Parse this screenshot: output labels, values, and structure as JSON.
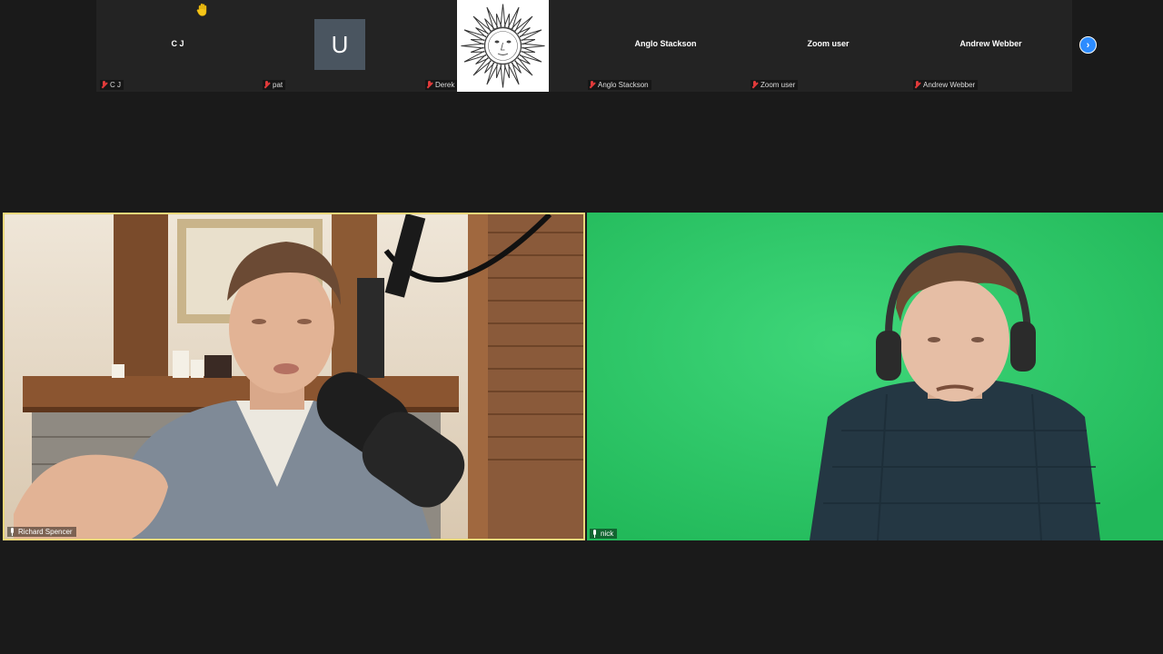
{
  "thumbnails": [
    {
      "name": "C J",
      "label": "C J",
      "muted": true
    },
    {
      "name": "",
      "label": "pat",
      "muted": true,
      "avatar_letter": "U"
    },
    {
      "name": "",
      "label": "Derek C",
      "muted": true
    },
    {
      "name": "Anglo Stackson",
      "label": "Anglo Stackson",
      "muted": true
    },
    {
      "name": "Zoom user",
      "label": "Zoom user",
      "muted": true
    },
    {
      "name": "Andrew Webber",
      "label": "Andrew Webber",
      "muted": true
    }
  ],
  "raised_hand_icon": "raised-hand-icon",
  "next_page_icon": "chevron-right-icon",
  "main": {
    "left": {
      "label": "Richard Spencer",
      "active_speaker": true
    },
    "right": {
      "label": "nick"
    }
  },
  "colors": {
    "background": "#1a1a1a",
    "tile": "#232323",
    "active_speaker_border": "#e9d77a",
    "accent": "#2d8cff",
    "muted_red": "#e03a3a",
    "green_screen": "#30c869"
  }
}
